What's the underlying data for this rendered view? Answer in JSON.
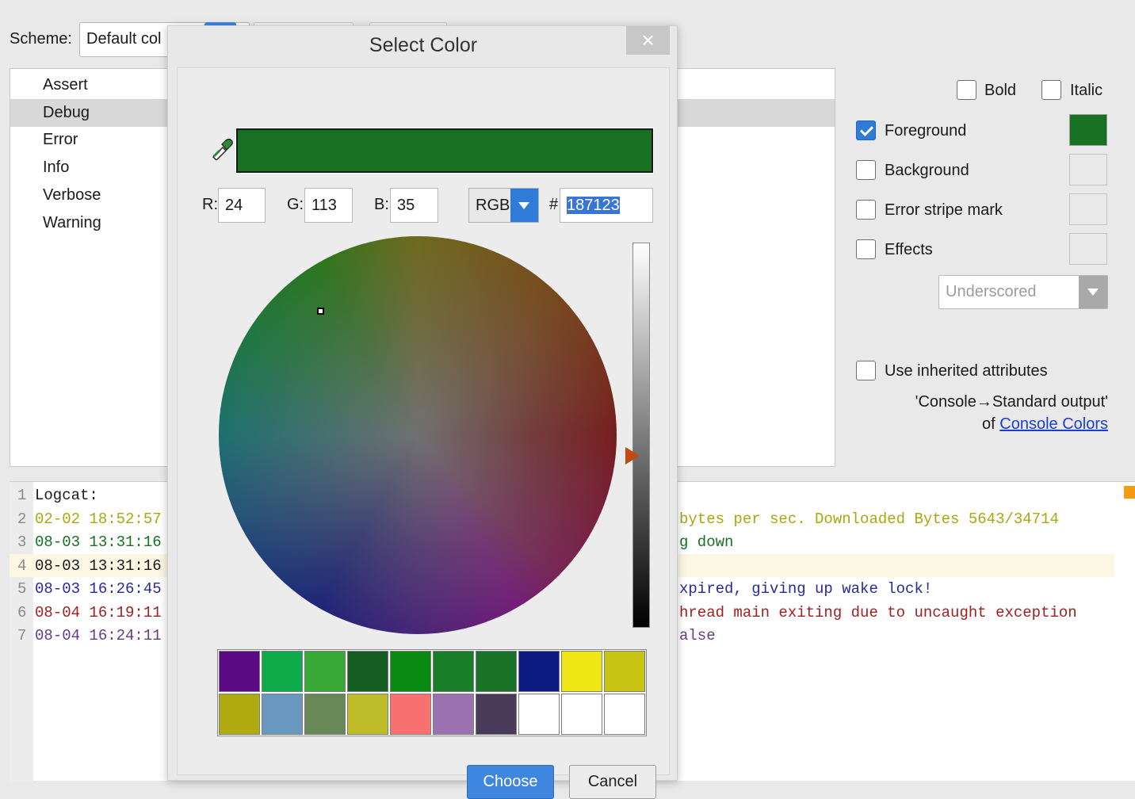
{
  "scheme": {
    "label": "Scheme:",
    "value": "Default col"
  },
  "attributes": {
    "items": [
      {
        "label": "Assert"
      },
      {
        "label": "Debug"
      },
      {
        "label": "Error"
      },
      {
        "label": "Info"
      },
      {
        "label": "Verbose"
      },
      {
        "label": "Warning"
      }
    ],
    "selected": "Debug"
  },
  "options": {
    "bold": "Bold",
    "italic": "Italic",
    "foreground": "Foreground",
    "background": "Background",
    "error_stripe": "Error stripe mark",
    "effects": "Effects",
    "effects_type": "Underscored",
    "use_inherited": "Use inherited attributes",
    "inherit_text": "'Console→Standard output'",
    "inherit_of": "of",
    "inherit_link": "Console Colors",
    "foreground_checked": true,
    "foreground_color": "#187123"
  },
  "preview": {
    "lines": [
      {
        "num": "1",
        "ts": "Logcat:",
        "tail": "",
        "color": "#1a1a1a"
      },
      {
        "num": "2",
        "ts": "02-02 18:52:57",
        "tail": " bytes per sec. Downloaded Bytes 5643/34714",
        "color": "#a8a80f"
      },
      {
        "num": "3",
        "ts": "08-03 13:31:16",
        "tail": "g down",
        "color": "#187123"
      },
      {
        "num": "4",
        "ts": "08-03 13:31:16",
        "tail": "",
        "color": "#1a1a1a"
      },
      {
        "num": "5",
        "ts": "08-03 16:26:45",
        "tail": "xpired, giving up wake lock!",
        "color": "#2a2a9a"
      },
      {
        "num": "6",
        "ts": "08-04 16:19:11",
        "tail": "hread main exiting due to uncaught exception",
        "color": "#a02020"
      },
      {
        "num": "7",
        "ts": "08-04 16:24:11",
        "tail": "alse",
        "color": "#6a3a8a"
      }
    ]
  },
  "dialog": {
    "title": "Select Color",
    "close": "×",
    "r_label": "R:",
    "r": "24",
    "g_label": "G:",
    "g": "113",
    "b_label": "B:",
    "b": "35",
    "mode": "RGB",
    "hash": "#",
    "hex": "187123",
    "current_color": "#187123",
    "recent_colors": [
      "#5a0a82",
      "#0faa4a",
      "#38a836",
      "#145c20",
      "#0a8a10",
      "#1a7e28",
      "#1a7428",
      "#0d1a82",
      "#eee615",
      "#c8c414",
      "#afaa0f",
      "#6898c0",
      "#688858",
      "#bfbc2a",
      "#f87070",
      "#9a72b0",
      "#4a3a5a",
      "#ffffff",
      "#ffffff",
      "#ffffff"
    ],
    "choose": "Choose",
    "cancel": "Cancel"
  }
}
